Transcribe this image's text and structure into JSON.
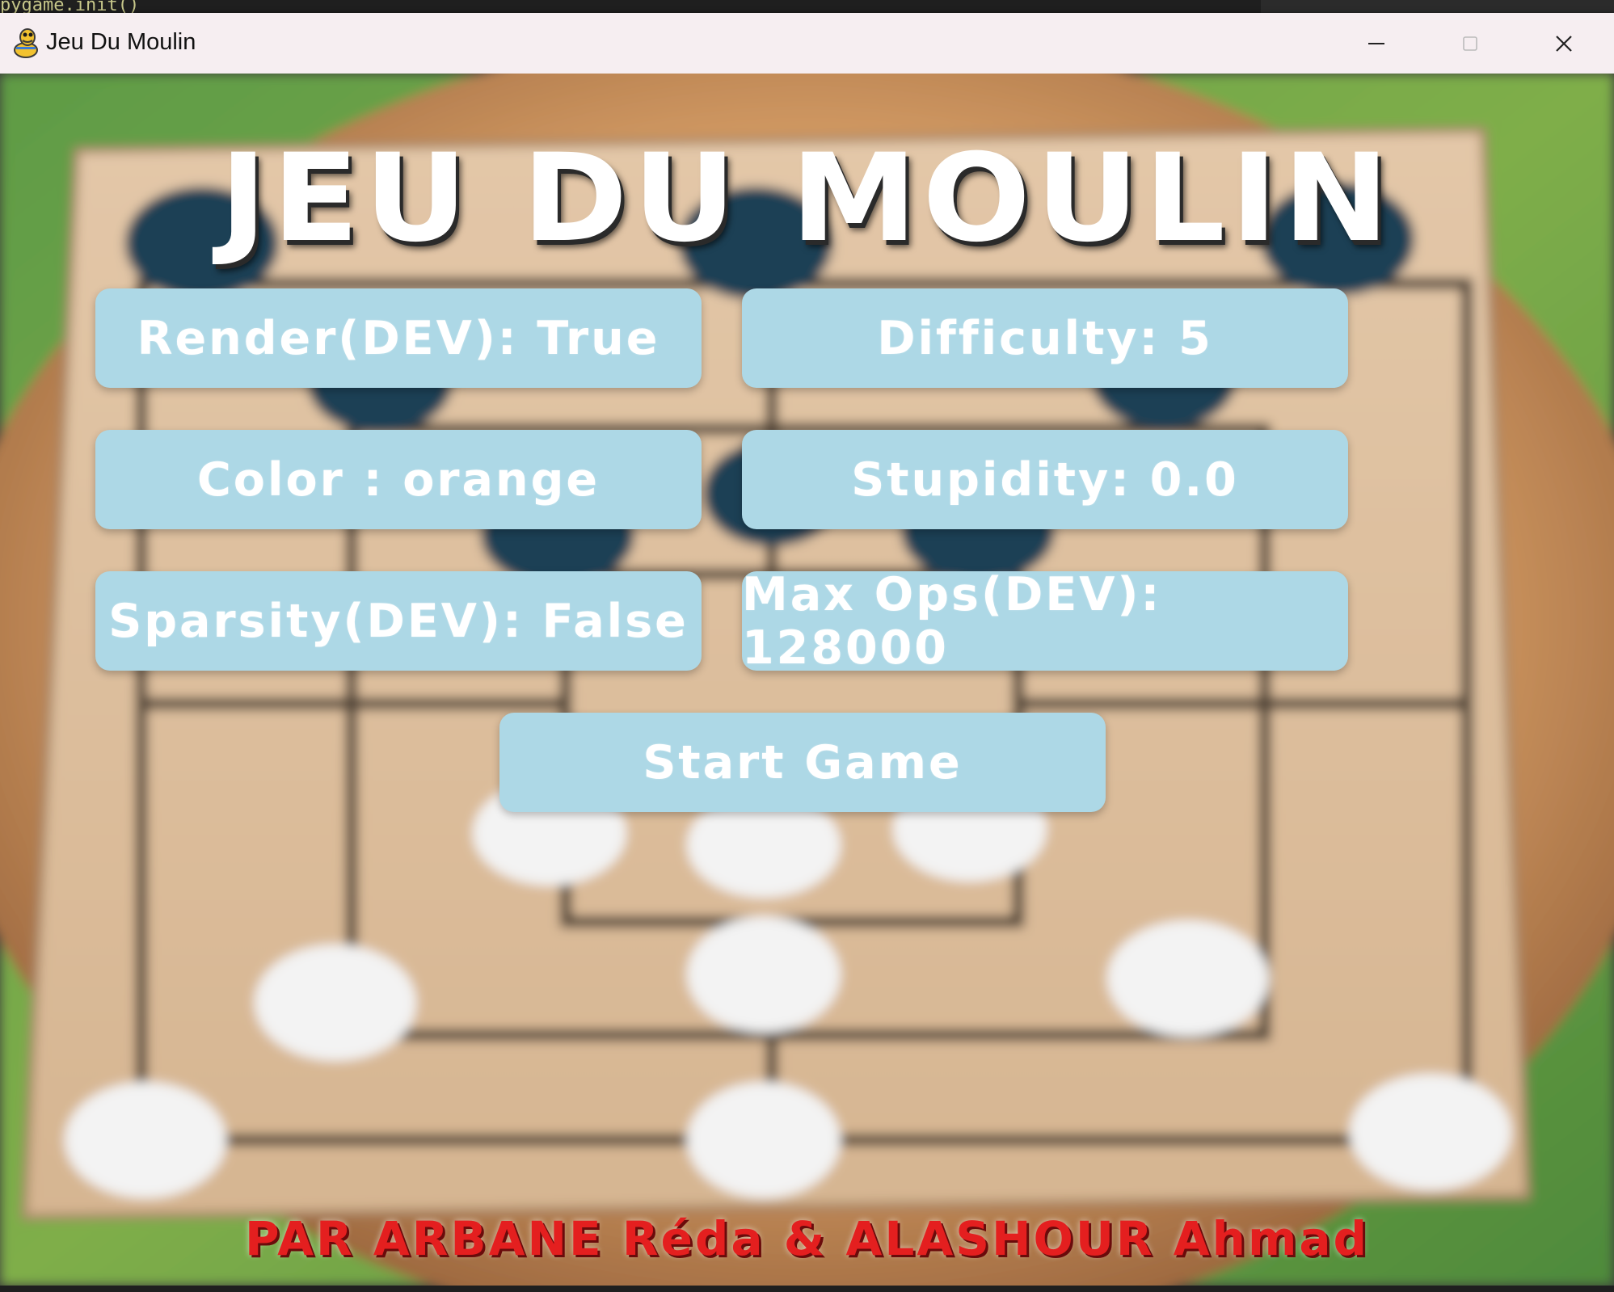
{
  "background_code": {
    "text": "pygame.init()"
  },
  "window": {
    "title": "Jeu Du Moulin",
    "icon": "pygame-snake-icon",
    "controls": [
      "minimize-icon",
      "maximize-icon",
      "close-icon"
    ]
  },
  "game": {
    "title": "JEU DU MOULIN",
    "buttons": {
      "render": "Render(DEV): True",
      "difficulty": "Difficulty: 5",
      "color": "Color : orange",
      "stupidity": "Stupidity: 0.0",
      "sparsity": "Sparsity(DEV): False",
      "max_ops": "Max Ops(DEV): 128000",
      "start": "Start Game"
    },
    "credits": "PAR ARBANE Réda & ALASHOUR Ahmad"
  },
  "colors": {
    "button_bg": "#add8e6",
    "button_text": "#ffffff",
    "credits_text": "#e41f1f",
    "titlebar_bg": "#f6eef1"
  }
}
